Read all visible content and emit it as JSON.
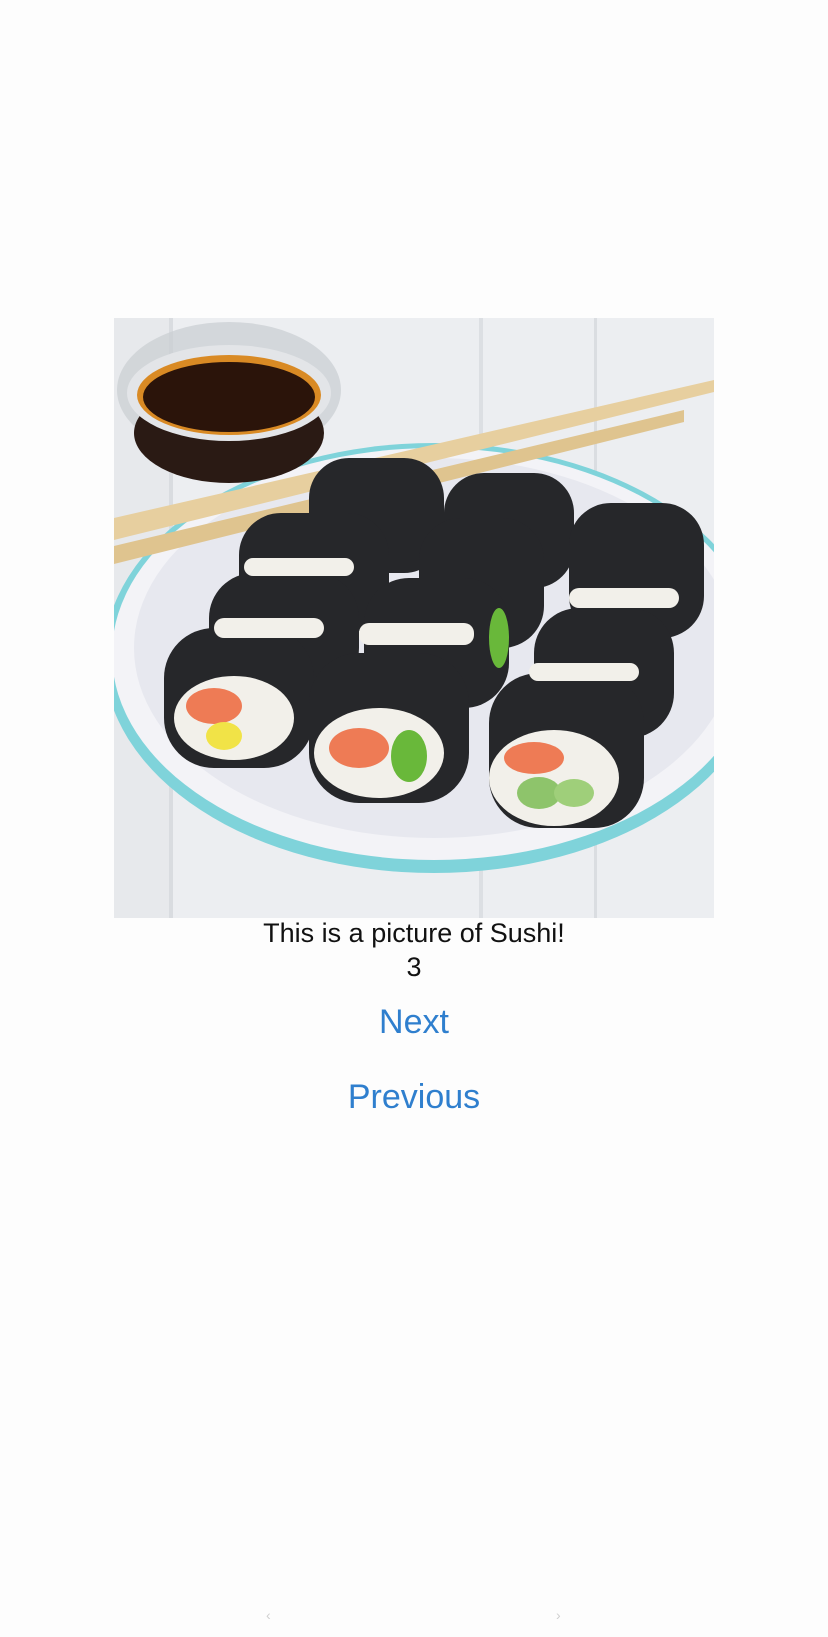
{
  "photo": {
    "subject": "Sushi"
  },
  "caption": {
    "title": "This is a picture of Sushi!",
    "counter": "3"
  },
  "buttons": {
    "next_label": "Next",
    "previous_label": "Previous"
  },
  "colors": {
    "link": "#2f7fce",
    "background": "#fdfdfd",
    "text": "#111111"
  }
}
